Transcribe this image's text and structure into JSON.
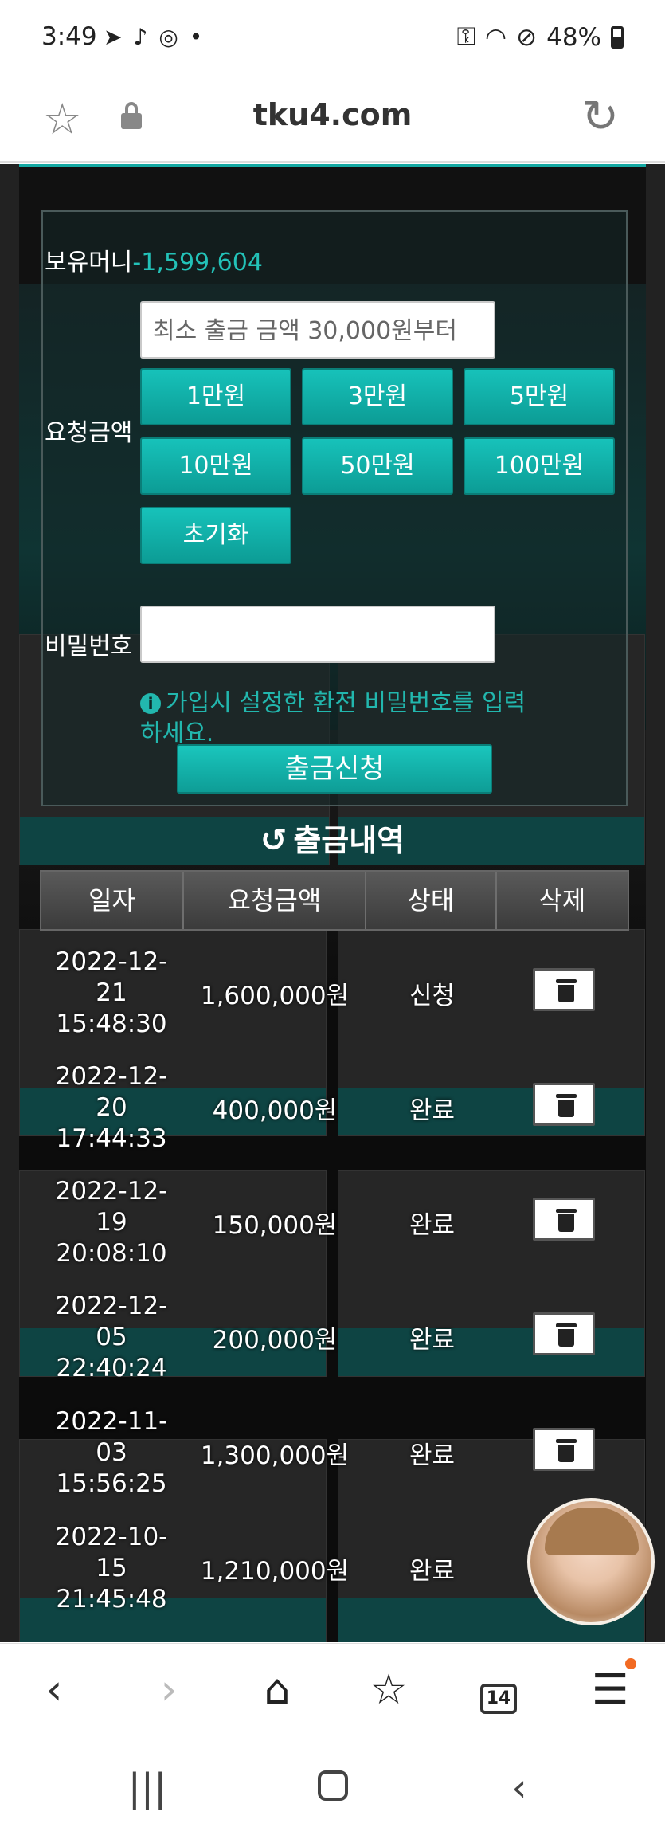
{
  "status_bar": {
    "time": "3:49",
    "battery": "48%"
  },
  "browser": {
    "url": "tku4.com",
    "tab_count": "14"
  },
  "withdraw_form": {
    "balance_label": "보유머니",
    "balance_value": "-1,599,604",
    "amount_label": "요청금액",
    "amount_placeholder": "최소 출금 금액 30,000원부터",
    "amount_buttons": [
      "1만원",
      "3만원",
      "5만원",
      "10만원",
      "50만원",
      "100만원"
    ],
    "reset_label": "초기화",
    "password_label": "비밀번호",
    "password_hint": "가입시 설정한 환전 비밀번호를 입력하세요.",
    "submit_label": "출금신청"
  },
  "history": {
    "title": "출금내역",
    "columns": [
      "일자",
      "요청금액",
      "상태",
      "삭제"
    ],
    "rows": [
      {
        "date_line1": "2022-12-",
        "date_line2": "21",
        "date_line3": "15:48:30",
        "amount": "1,600,000원",
        "status": "신청"
      },
      {
        "date_line1": "2022-12-",
        "date_line2": "20",
        "date_line3": "17:44:33",
        "amount": "400,000원",
        "status": "완료"
      },
      {
        "date_line1": "2022-12-",
        "date_line2": "19",
        "date_line3": "20:08:10",
        "amount": "150,000원",
        "status": "완료"
      },
      {
        "date_line1": "2022-12-",
        "date_line2": "05",
        "date_line3": "22:40:24",
        "amount": "200,000원",
        "status": "완료"
      },
      {
        "date_line1": "2022-11-",
        "date_line2": "03",
        "date_line3": "15:56:25",
        "amount": "1,300,000원",
        "status": "완료"
      },
      {
        "date_line1": "2022-10-",
        "date_line2": "15",
        "date_line3": "21:45:48",
        "amount": "1,210,000원",
        "status": "완료"
      }
    ]
  }
}
